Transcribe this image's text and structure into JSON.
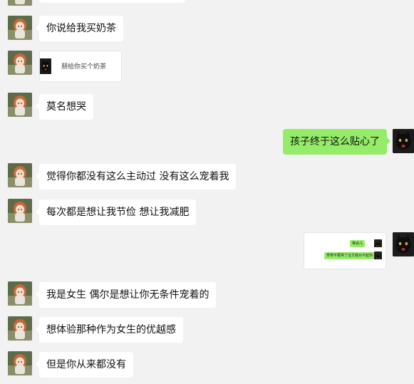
{
  "messages": [
    {
      "text": "你说给我买奶茶"
    },
    {
      "text": "朋给你买个奶茶"
    },
    {
      "text": "莫名想哭"
    },
    {
      "text": "孩子终于这么贴心了"
    },
    {
      "text": "觉得你都没有这么主动过  没有这么宠着我"
    },
    {
      "text": "每次都是想让我节俭  想让我减肥"
    },
    {
      "text": "我是女生  偶尔是想让你无条件宠着的"
    },
    {
      "text": "想体验那种作为女生的优越感"
    },
    {
      "text": "但是你从来都没有"
    }
  ],
  "nested_screenshot": {
    "line1": "等会儿",
    "line2": "乖乖不要哭了宝贝我对不起你"
  },
  "colors": {
    "background": "#f2f2f2",
    "sent_bubble": "#95ec69",
    "received_bubble": "#ffffff"
  },
  "icons": {
    "girl_avatar": "anime-girl-avatar-icon",
    "cat_avatar": "black-cat-avatar-icon"
  }
}
